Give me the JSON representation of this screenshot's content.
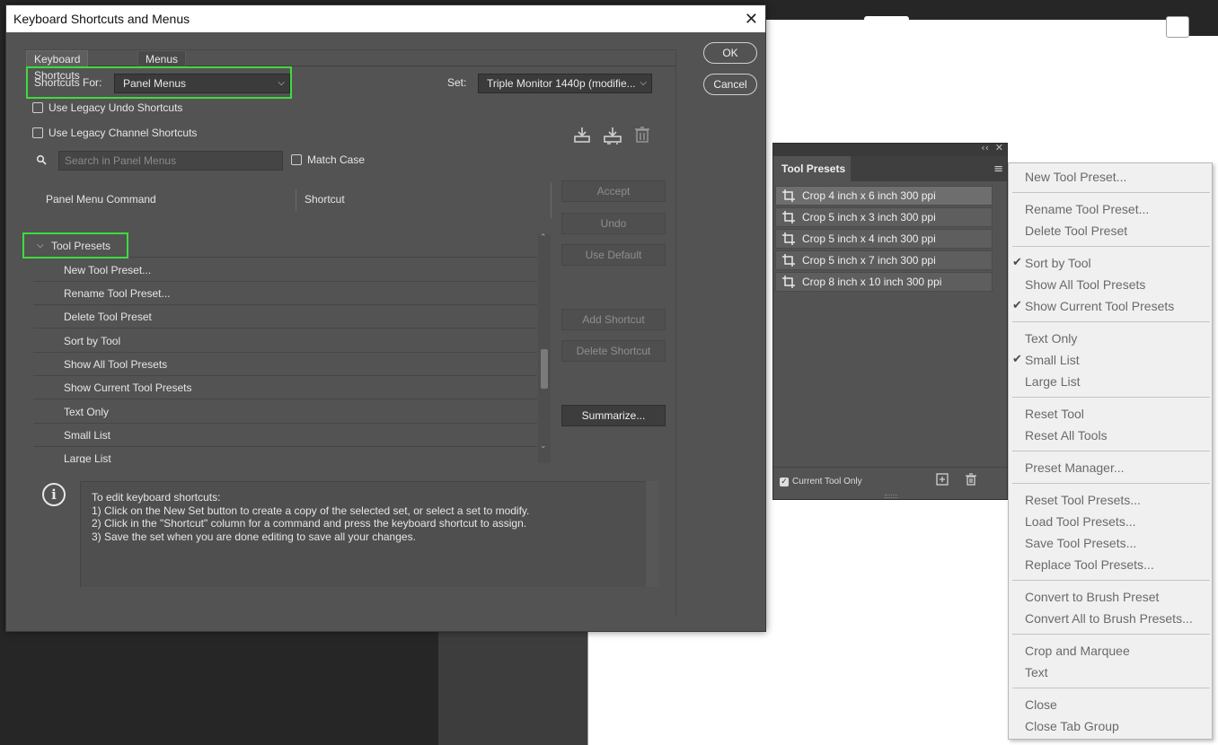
{
  "dialog": {
    "title": "Keyboard Shortcuts and Menus",
    "tabs": [
      "Keyboard Shortcuts",
      "Menus"
    ],
    "shortcuts_for_label": "Shortcuts For:",
    "shortcuts_for_value": "Panel Menus",
    "set_label": "Set:",
    "set_value": "Triple Monitor 1440p (modifie...",
    "legacy_undo": "Use Legacy Undo Shortcuts",
    "legacy_channel": "Use Legacy Channel Shortcuts",
    "search_placeholder": "Search in Panel Menus",
    "match_case": "Match Case",
    "col_command": "Panel Menu Command",
    "col_shortcut": "Shortcut",
    "group": "Tool Presets",
    "rows": [
      "New Tool Preset...",
      "Rename Tool Preset...",
      "Delete Tool Preset",
      "Sort by Tool",
      "Show All Tool Presets",
      "Show Current Tool Presets",
      "Text Only",
      "Small List",
      "Large List"
    ],
    "buttons": {
      "accept": "Accept",
      "undo": "Undo",
      "use_default": "Use Default",
      "add_shortcut": "Add Shortcut",
      "delete_shortcut": "Delete Shortcut",
      "summarize": "Summarize...",
      "ok": "OK",
      "cancel": "Cancel"
    },
    "info_lines": [
      "To edit keyboard shortcuts:",
      "1) Click on the New Set button to create a copy of the selected set, or select a set to modify.",
      "2) Click in the \"Shortcut\" column for a command and press the keyboard shortcut to assign.",
      "3) Save the set when you are done editing to save all your changes."
    ]
  },
  "tool_presets": {
    "title": "Tool Presets",
    "items": [
      "Crop 4 inch x 6 inch 300 ppi",
      "Crop 5 inch x 3 inch 300 ppi",
      "Crop 5 inch x 4 inch 300 ppi",
      "Crop 5 inch x 7 inch 300 ppi",
      "Crop 8 inch x 10 inch 300 ppi"
    ],
    "current_tool_only": "Current Tool Only"
  },
  "context_menu": {
    "items": [
      {
        "label": "New Tool Preset...",
        "checked": false
      },
      {
        "label": "Rename Tool Preset...",
        "checked": false
      },
      {
        "label": "Delete Tool Preset",
        "checked": false
      },
      {
        "label": "Sort by Tool",
        "checked": true
      },
      {
        "label": "Show All Tool Presets",
        "checked": false
      },
      {
        "label": "Show Current Tool Presets",
        "checked": true
      },
      {
        "label": "Text Only",
        "checked": false
      },
      {
        "label": "Small List",
        "checked": true
      },
      {
        "label": "Large List",
        "checked": false
      },
      {
        "label": "Reset Tool",
        "checked": false
      },
      {
        "label": "Reset All Tools",
        "checked": false
      },
      {
        "label": "Preset Manager...",
        "checked": false
      },
      {
        "label": "Reset Tool Presets...",
        "checked": false
      },
      {
        "label": "Load Tool Presets...",
        "checked": false
      },
      {
        "label": "Save Tool Presets...",
        "checked": false
      },
      {
        "label": "Replace Tool Presets...",
        "checked": false
      },
      {
        "label": "Convert to Brush Preset",
        "checked": false
      },
      {
        "label": "Convert All to Brush Presets...",
        "checked": false
      },
      {
        "label": "Crop and Marquee",
        "checked": false
      },
      {
        "label": "Text",
        "checked": false
      },
      {
        "label": "Close",
        "checked": false
      },
      {
        "label": "Close Tab Group",
        "checked": false
      }
    ]
  },
  "colors": {
    "highlight": "#3ddc3d",
    "dialog_bg": "#535353",
    "menu_bg": "#f0f0f0"
  }
}
